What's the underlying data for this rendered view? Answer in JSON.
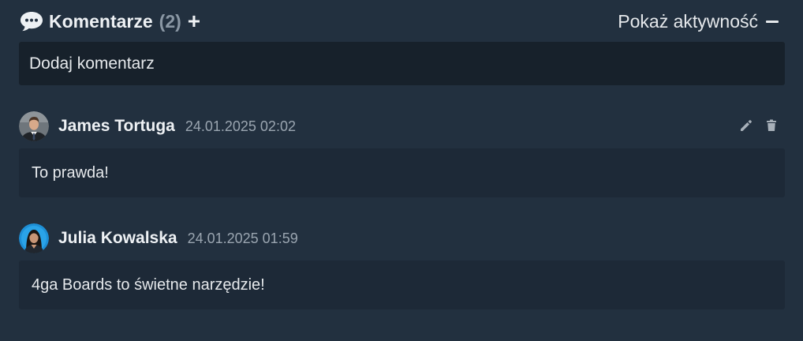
{
  "header": {
    "title": "Komentarze",
    "count": "(2)",
    "add_icon": "plus-icon",
    "activity_toggle": "Pokaż aktywność",
    "comments_icon": "speech-bubble-icon"
  },
  "add_comment": {
    "placeholder": "Dodaj komentarz"
  },
  "comments": [
    {
      "author": "James Tortuga",
      "timestamp": "24.01.2025 02:02",
      "text": "To prawda!",
      "actions": [
        "pencil-icon",
        "trash-icon"
      ]
    },
    {
      "author": "Julia Kowalska",
      "timestamp": "24.01.2025 01:59",
      "text": "4ga Boards to świetne narzędzie!"
    }
  ],
  "colors": {
    "background": "#22303f",
    "input_background": "#17212b",
    "comment_background": "#1d2937",
    "muted_text": "#9aa5b0",
    "avatar_ring": "#1e8fd6"
  }
}
